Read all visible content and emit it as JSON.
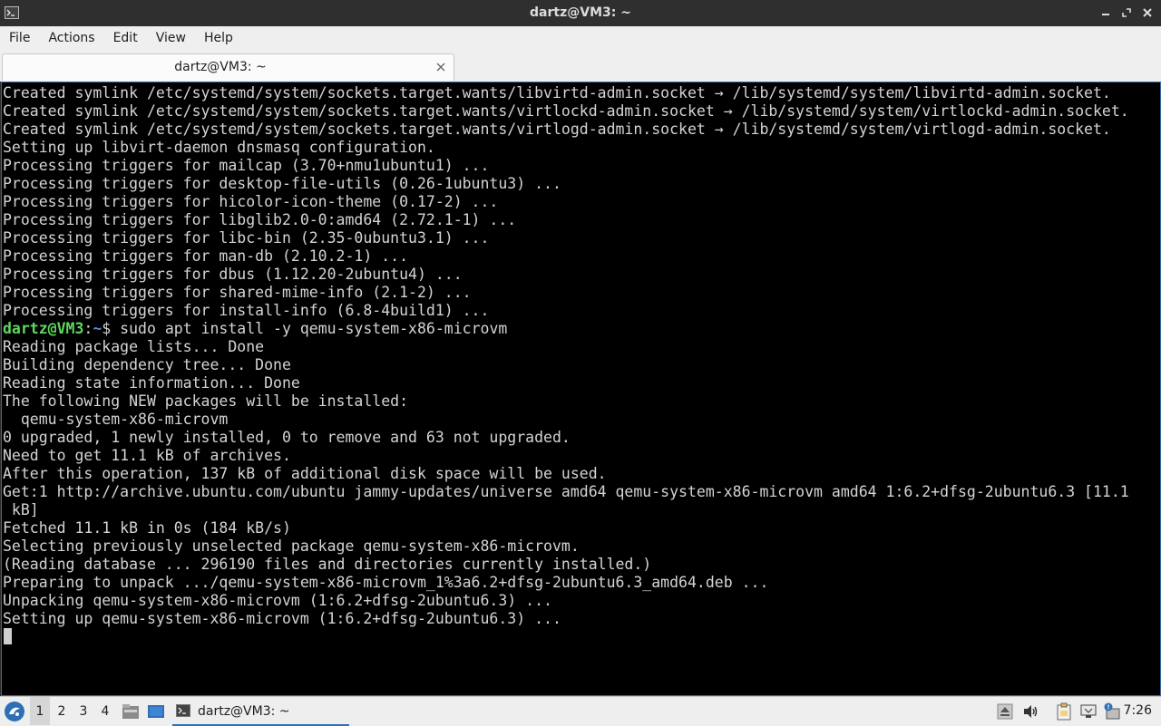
{
  "window": {
    "title": "dartz@VM3: ~",
    "app_icon": "terminal-icon"
  },
  "menu": [
    "File",
    "Actions",
    "Edit",
    "View",
    "Help"
  ],
  "tab": {
    "label": "dartz@VM3: ~"
  },
  "terminal": {
    "lines_before": [
      "Created symlink /etc/systemd/system/sockets.target.wants/libvirtd-admin.socket → /lib/systemd/system/libvirtd-admin.socket.",
      "Created symlink /etc/systemd/system/sockets.target.wants/virtlockd-admin.socket → /lib/systemd/system/virtlockd-admin.socket.",
      "Created symlink /etc/systemd/system/sockets.target.wants/virtlogd-admin.socket → /lib/systemd/system/virtlogd-admin.socket.",
      "Setting up libvirt-daemon dnsmasq configuration.",
      "Processing triggers for mailcap (3.70+nmu1ubuntu1) ...",
      "Processing triggers for desktop-file-utils (0.26-1ubuntu3) ...",
      "Processing triggers for hicolor-icon-theme (0.17-2) ...",
      "Processing triggers for libglib2.0-0:amd64 (2.72.1-1) ...",
      "Processing triggers for libc-bin (2.35-0ubuntu3.1) ...",
      "Processing triggers for man-db (2.10.2-1) ...",
      "Processing triggers for dbus (1.12.20-2ubuntu4) ...",
      "Processing triggers for shared-mime-info (2.1-2) ...",
      "Processing triggers for install-info (6.8-4build1) ..."
    ],
    "prompt": {
      "user_host": "dartz@VM3",
      "colon": ":",
      "path": "~",
      "symbol": "$ ",
      "command": "sudo apt install -y qemu-system-x86-microvm"
    },
    "lines_after": [
      "Reading package lists... Done",
      "Building dependency tree... Done",
      "Reading state information... Done",
      "The following NEW packages will be installed:",
      "  qemu-system-x86-microvm",
      "0 upgraded, 1 newly installed, 0 to remove and 63 not upgraded.",
      "Need to get 11.1 kB of archives.",
      "After this operation, 137 kB of additional disk space will be used.",
      "Get:1 http://archive.ubuntu.com/ubuntu jammy-updates/universe amd64 qemu-system-x86-microvm amd64 1:6.2+dfsg-2ubuntu6.3 [11.1",
      " kB]",
      "Fetched 11.1 kB in 0s (184 kB/s)",
      "Selecting previously unselected package qemu-system-x86-microvm.",
      "(Reading database ... 296190 files and directories currently installed.)",
      "Preparing to unpack .../qemu-system-x86-microvm_1%3a6.2+dfsg-2ubuntu6.3_amd64.deb ...",
      "Unpacking qemu-system-x86-microvm (1:6.2+dfsg-2ubuntu6.3) ...",
      "Setting up qemu-system-x86-microvm (1:6.2+dfsg-2ubuntu6.3) ..."
    ]
  },
  "taskbar": {
    "workspaces": [
      "1",
      "2",
      "3",
      "4"
    ],
    "active_workspace": "1",
    "window_label": "dartz@VM3: ~",
    "time": "7:26"
  },
  "colors": {
    "terminal_bg": "#000000",
    "terminal_fg": "#d4d4d4",
    "prompt_user": "#5fd75f",
    "prompt_path": "#5f87d7",
    "accent": "#2f6fb5"
  }
}
